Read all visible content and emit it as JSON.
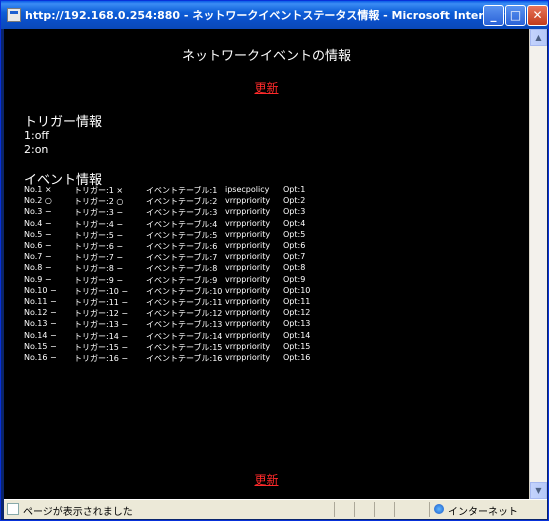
{
  "window": {
    "title": "http://192.168.0.254:880 - ネットワークイベントステータス情報 - Microsoft Internet Ex...",
    "min_glyph": "_",
    "max_glyph": "□",
    "close_glyph": "✕"
  },
  "page": {
    "title": "ネットワークイベントの情報",
    "refresh_label": "更新",
    "trigger_heading": "トリガー情報",
    "triggers": [
      "1:off",
      "2:on"
    ],
    "event_heading": "イベント情報",
    "events": [
      {
        "no": "No.1 ×",
        "trigger": "トリガー:1 ×",
        "table": "イベントテーブル:1",
        "name": "ipsecpolicy",
        "opt": "Opt:1"
      },
      {
        "no": "No.2 ○",
        "trigger": "トリガー:2 ○",
        "table": "イベントテーブル:2",
        "name": "vrrppriority",
        "opt": "Opt:2"
      },
      {
        "no": "No.3 −",
        "trigger": "トリガー:3 −",
        "table": "イベントテーブル:3",
        "name": "vrrppriority",
        "opt": "Opt:3"
      },
      {
        "no": "No.4 −",
        "trigger": "トリガー:4 −",
        "table": "イベントテーブル:4",
        "name": "vrrppriority",
        "opt": "Opt:4"
      },
      {
        "no": "No.5 −",
        "trigger": "トリガー:5 −",
        "table": "イベントテーブル:5",
        "name": "vrrppriority",
        "opt": "Opt:5"
      },
      {
        "no": "No.6 −",
        "trigger": "トリガー:6 −",
        "table": "イベントテーブル:6",
        "name": "vrrppriority",
        "opt": "Opt:6"
      },
      {
        "no": "No.7 −",
        "trigger": "トリガー:7 −",
        "table": "イベントテーブル:7",
        "name": "vrrppriority",
        "opt": "Opt:7"
      },
      {
        "no": "No.8 −",
        "trigger": "トリガー:8 −",
        "table": "イベントテーブル:8",
        "name": "vrrppriority",
        "opt": "Opt:8"
      },
      {
        "no": "No.9 −",
        "trigger": "トリガー:9 −",
        "table": "イベントテーブル:9",
        "name": "vrrppriority",
        "opt": "Opt:9"
      },
      {
        "no": "No.10 −",
        "trigger": "トリガー:10 −",
        "table": "イベントテーブル:10",
        "name": "vrrppriority",
        "opt": "Opt:10"
      },
      {
        "no": "No.11 −",
        "trigger": "トリガー:11 −",
        "table": "イベントテーブル:11",
        "name": "vrrppriority",
        "opt": "Opt:11"
      },
      {
        "no": "No.12 −",
        "trigger": "トリガー:12 −",
        "table": "イベントテーブル:12",
        "name": "vrrppriority",
        "opt": "Opt:12"
      },
      {
        "no": "No.13 −",
        "trigger": "トリガー:13 −",
        "table": "イベントテーブル:13",
        "name": "vrrppriority",
        "opt": "Opt:13"
      },
      {
        "no": "No.14 −",
        "trigger": "トリガー:14 −",
        "table": "イベントテーブル:14",
        "name": "vrrppriority",
        "opt": "Opt:14"
      },
      {
        "no": "No.15 −",
        "trigger": "トリガー:15 −",
        "table": "イベントテーブル:15",
        "name": "vrrppriority",
        "opt": "Opt:15"
      },
      {
        "no": "No.16 −",
        "trigger": "トリガー:16 −",
        "table": "イベントテーブル:16",
        "name": "vrrppriority",
        "opt": "Opt:16"
      }
    ]
  },
  "scrollbar": {
    "up_glyph": "▲",
    "down_glyph": "▼"
  },
  "status": {
    "text": "ページが表示されました",
    "zone": "インターネット"
  },
  "colors": {
    "link": "#ff2a2a",
    "background": "#000000",
    "text": "#ffffff"
  }
}
